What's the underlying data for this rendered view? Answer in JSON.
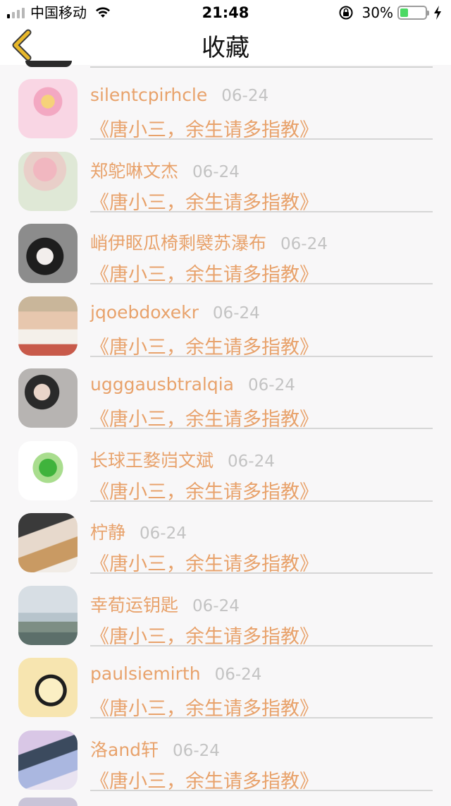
{
  "status_bar": {
    "carrier": "中国移动",
    "time": "21:48",
    "battery_percent": "30%",
    "battery_level": 0.3,
    "signal_bars_active": 1,
    "signal_bars_total": 4
  },
  "nav": {
    "title": "收藏",
    "back_icon": "chevron-left-icon",
    "accent_color": "#e8b82a"
  },
  "colors": {
    "name": "#e8a26b",
    "date": "#c3c3c3",
    "divider": "#d6d6d6",
    "background": "#f8f7f8"
  },
  "favorites": [
    {
      "name": "silentcpirhcle",
      "date": "06-24",
      "book": "《唐小三，余生请多指教》",
      "avatar": "buddha-avatar"
    },
    {
      "name": "郑鸵啉文杰",
      "date": "06-24",
      "book": "《唐小三，余生请多指教》",
      "avatar": "flowers-avatar"
    },
    {
      "name": "峭伊眍瓜椅剩襞苏瀑布",
      "date": "06-24",
      "book": "《唐小三，余生请多指教》",
      "avatar": "masked-person-avatar"
    },
    {
      "name": "jqoebdoxekr",
      "date": "06-24",
      "book": "《唐小三，余生请多指教》",
      "avatar": "girl-snack-avatar"
    },
    {
      "name": "ugggausbtralqia",
      "date": "06-24",
      "book": "《唐小三，余生请多指教》",
      "avatar": "girl-portrait-avatar"
    },
    {
      "name": "长球王婺岿文斌",
      "date": "06-24",
      "book": "《唐小三，余生请多指教》",
      "avatar": "jade-cabbage-avatar"
    },
    {
      "name": "柠静",
      "date": "06-24",
      "book": "《唐小三，余生请多指教》",
      "avatar": "girl-dog-avatar"
    },
    {
      "name": "幸荀运钥匙",
      "date": "06-24",
      "book": "《唐小三，余生请多指教》",
      "avatar": "seaside-avatar"
    },
    {
      "name": "paulsiemirth",
      "date": "06-24",
      "book": "《唐小三，余生请多指教》",
      "avatar": "anime-face-avatar"
    },
    {
      "name": "洛and轩",
      "date": "06-24",
      "book": "《唐小三，余生请多指教》",
      "avatar": "anime-scene-avatar"
    }
  ]
}
